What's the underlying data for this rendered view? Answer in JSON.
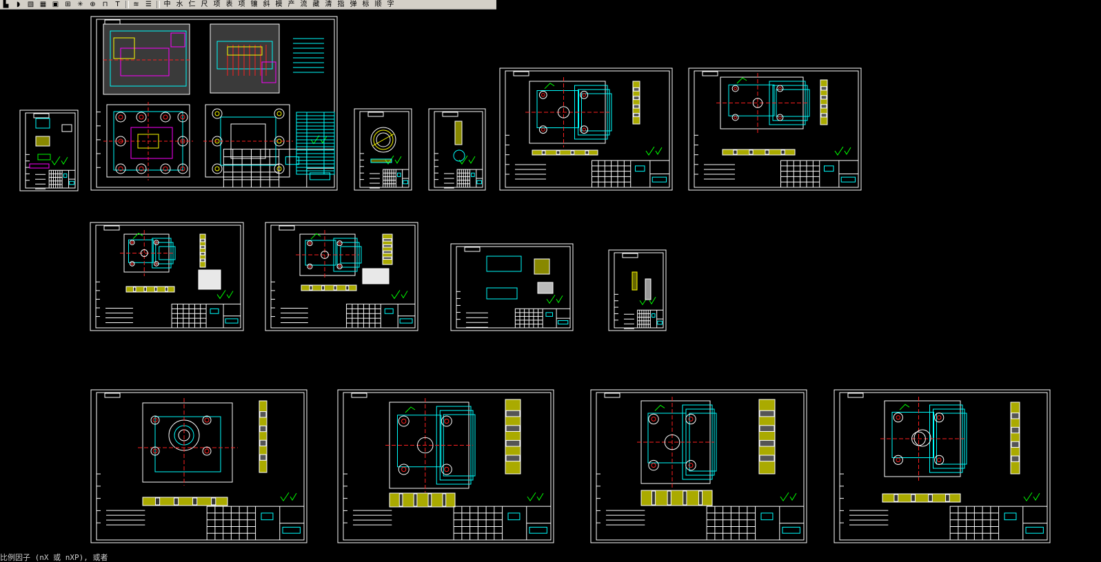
{
  "toolbar": {
    "buttons": [
      {
        "label": "",
        "icon": "pline-icon"
      },
      {
        "label": "",
        "icon": "arc-icon"
      },
      {
        "label": "",
        "icon": "hatch-icon"
      },
      {
        "label": "",
        "icon": "table-icon"
      },
      {
        "label": "",
        "icon": "block-icon"
      },
      {
        "label": "",
        "icon": "insert-icon"
      },
      {
        "label": "",
        "icon": "explode-icon"
      },
      {
        "label": "",
        "icon": "circle-target-icon"
      },
      {
        "label": "",
        "icon": "dimension-icon"
      },
      {
        "label": "",
        "icon": "text-icon"
      },
      {
        "label": "",
        "icon": "layers-icon"
      },
      {
        "label": "",
        "icon": "layer-stack-icon"
      },
      {
        "label": "中",
        "icon": "text-glyph"
      },
      {
        "label": "水",
        "icon": "text-glyph"
      },
      {
        "label": "仁",
        "icon": "text-glyph"
      },
      {
        "label": "尺",
        "icon": "text-glyph"
      },
      {
        "label": "项",
        "icon": "text-glyph"
      },
      {
        "label": "表",
        "icon": "text-glyph"
      },
      {
        "label": "项",
        "icon": "text-glyph"
      },
      {
        "label": "镶",
        "icon": "text-glyph"
      },
      {
        "label": "斜",
        "icon": "text-glyph"
      },
      {
        "label": "模",
        "icon": "text-glyph"
      },
      {
        "label": "产",
        "icon": "text-glyph"
      },
      {
        "label": "流",
        "icon": "text-glyph"
      },
      {
        "label": "藏",
        "icon": "text-glyph"
      },
      {
        "label": "清",
        "icon": "text-glyph"
      },
      {
        "label": "指",
        "icon": "text-glyph"
      },
      {
        "label": "弹",
        "icon": "text-glyph"
      },
      {
        "label": "标",
        "icon": "text-glyph"
      },
      {
        "label": "顺",
        "icon": "text-glyph"
      },
      {
        "label": "字",
        "icon": "text-glyph"
      }
    ]
  },
  "command_line": {
    "text": "比例因子 (nX 或 nXP), 或者"
  },
  "colors": {
    "background": "#000000",
    "frame": "#ffffff",
    "cyan": "#00ffff",
    "yellow": "#ffff00",
    "red": "#ff2020",
    "green": "#00ff00",
    "magenta": "#ff00ff"
  }
}
